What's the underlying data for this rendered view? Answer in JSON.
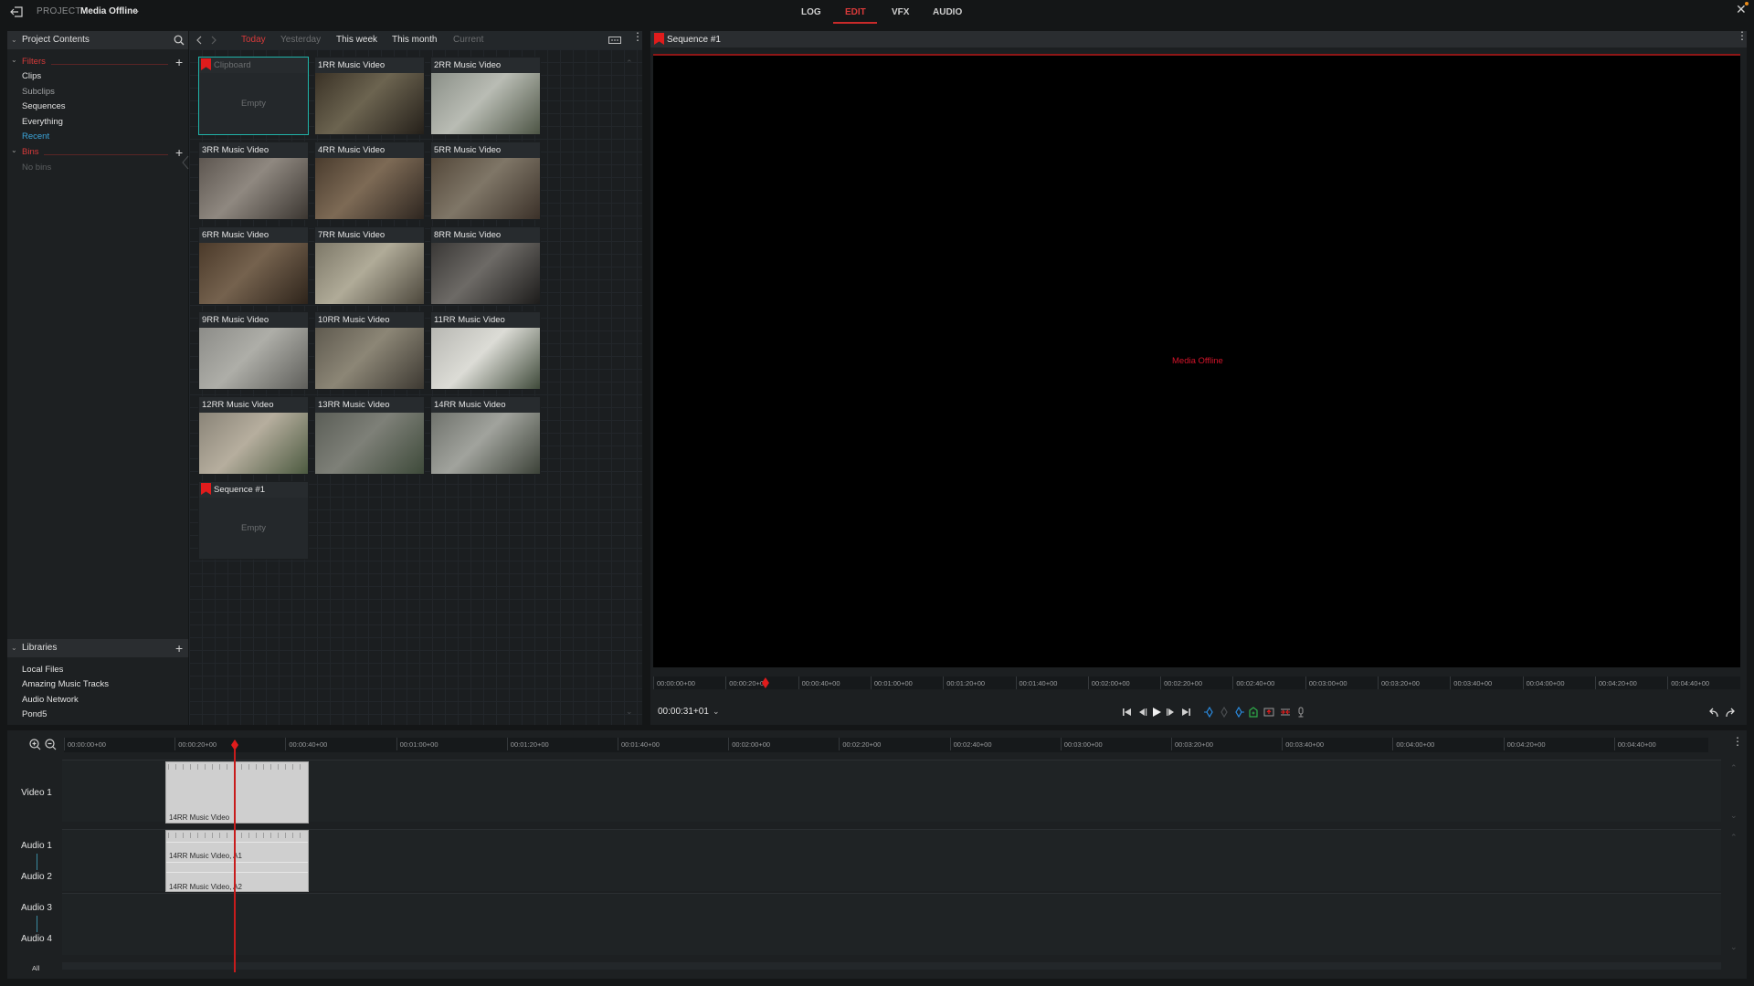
{
  "topbar": {
    "project_label": "PROJECT",
    "project_name": "Media Offline",
    "modes": [
      "LOG",
      "EDIT",
      "VFX",
      "AUDIO"
    ],
    "active_mode": "EDIT",
    "close_symbol": "✕"
  },
  "project_contents": {
    "title": "Project Contents",
    "filters_label": "Filters",
    "filters": [
      {
        "label": "Clips",
        "state": "normal"
      },
      {
        "label": "Subclips",
        "state": "dim"
      },
      {
        "label": "Sequences",
        "state": "normal"
      },
      {
        "label": "Everything",
        "state": "normal"
      },
      {
        "label": "Recent",
        "state": "active"
      }
    ],
    "bins_label": "Bins",
    "bins_empty": "No bins"
  },
  "libraries": {
    "title": "Libraries",
    "items": [
      "Local Files",
      "Amazing Music Tracks",
      "Audio Network",
      "Pond5"
    ]
  },
  "browser": {
    "date_tabs": [
      {
        "label": "Today",
        "state": "active"
      },
      {
        "label": "Yesterday",
        "state": "dim"
      },
      {
        "label": "This week",
        "state": "normal"
      },
      {
        "label": "This month",
        "state": "normal"
      },
      {
        "label": "Current",
        "state": "dim"
      }
    ],
    "tiles": [
      {
        "title": "Clipboard",
        "empty": "Empty",
        "bookmark": true,
        "selected": true,
        "thumb": null
      },
      {
        "title": "1RR Music Video",
        "thumb": [
          "#3a3226",
          "#6c6450",
          "#25201a"
        ]
      },
      {
        "title": "2RR Music Video",
        "thumb": [
          "#8b9088",
          "#b9bcb4",
          "#4d5545"
        ]
      },
      {
        "title": "3RR Music Video",
        "thumb": [
          "#5d5650",
          "#8f8880",
          "#3b3631"
        ]
      },
      {
        "title": "4RR Music Video",
        "thumb": [
          "#4a3c2e",
          "#7d6a55",
          "#2e2620"
        ]
      },
      {
        "title": "5RR Music Video",
        "thumb": [
          "#54483a",
          "#7f7667",
          "#3b3129"
        ]
      },
      {
        "title": "6RR Music Video",
        "thumb": [
          "#4b3a2a",
          "#75624e",
          "#2e241b"
        ]
      },
      {
        "title": "7RR Music Video",
        "thumb": [
          "#7d7868",
          "#b0ab98",
          "#4c473c"
        ]
      },
      {
        "title": "8RR Music Video",
        "thumb": [
          "#3a3836",
          "#6d6a66",
          "#1d1c1b"
        ]
      },
      {
        "title": "9RR Music Video",
        "thumb": [
          "#8c8c88",
          "#aeaea8",
          "#5e5e5a"
        ]
      },
      {
        "title": "10RR Music Video",
        "thumb": [
          "#5f5a4f",
          "#8c8676",
          "#3d3932"
        ]
      },
      {
        "title": "11RR Music Video",
        "thumb": [
          "#b7b7b2",
          "#dcdcd6",
          "#3f4a3a"
        ]
      },
      {
        "title": "12RR Music Video",
        "thumb": [
          "#8a8478",
          "#b6ae9e",
          "#4c5a40"
        ]
      },
      {
        "title": "13RR Music Video",
        "thumb": [
          "#5b5e57",
          "#7e8078",
          "#3e4a3a"
        ]
      },
      {
        "title": "14RR Music Video",
        "thumb": [
          "#6f726c",
          "#a1a39d",
          "#3c4238"
        ]
      },
      {
        "title": "Sequence #1",
        "empty": "Empty",
        "bookmark": true,
        "selected": false,
        "thumb": null
      }
    ]
  },
  "viewer": {
    "title": "Sequence #1",
    "status": "Media Offline",
    "ruler_ticks": [
      "00:00:00+00",
      "00:00:20+00",
      "00:00:40+00",
      "00:01:00+00",
      "00:01:20+00",
      "00:01:40+00",
      "00:02:00+00",
      "00:02:20+00",
      "00:02:40+00",
      "00:03:00+00",
      "00:03:20+00",
      "00:03:40+00",
      "00:04:00+00",
      "00:04:20+00",
      "00:04:40+00"
    ],
    "timecode": "00:00:31+01",
    "playhead_seconds": 31
  },
  "timeline": {
    "ruler_ticks": [
      "00:00:00+00",
      "00:00:20+00",
      "00:00:40+00",
      "00:01:00+00",
      "00:01:20+00",
      "00:01:40+00",
      "00:02:00+00",
      "00:02:20+00",
      "00:02:40+00",
      "00:03:00+00",
      "00:03:20+00",
      "00:03:40+00",
      "00:04:00+00",
      "00:04:20+00",
      "00:04:40+00"
    ],
    "tracks": {
      "video1": "Video 1",
      "audio1": "Audio 1",
      "audio2": "Audio 2",
      "audio3": "Audio 3",
      "audio4": "Audio 4",
      "all": "All"
    },
    "clips": {
      "video": "14RR Music Video",
      "audio_a1": "14RR Music Video, A1",
      "audio_a2": "14RR Music Video, A2"
    }
  }
}
